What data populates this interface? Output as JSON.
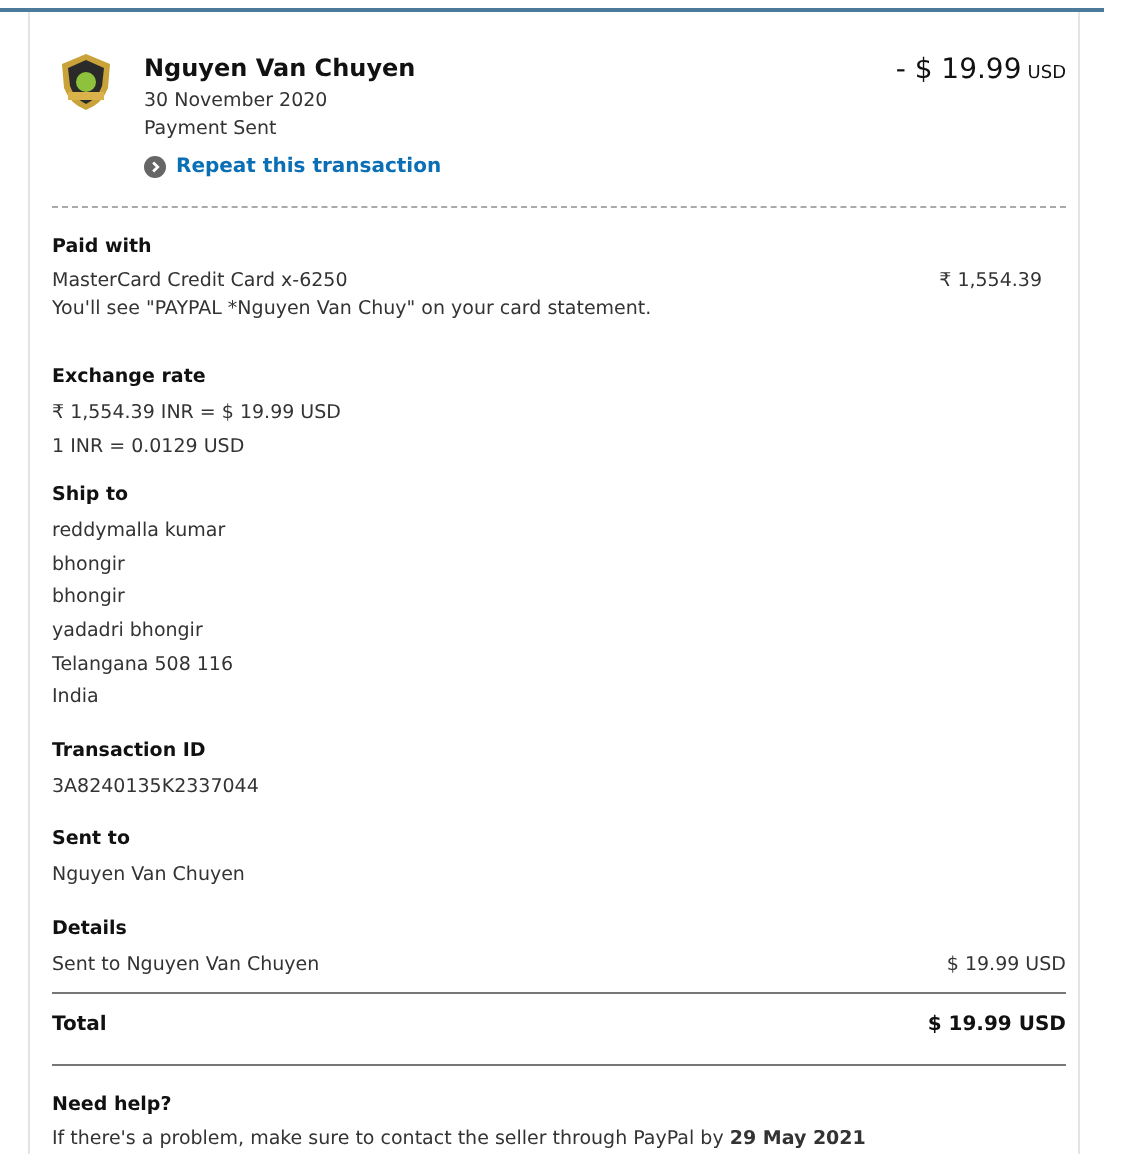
{
  "header": {
    "name": "Nguyen Van Chuyen",
    "date": "30 November 2020",
    "status": "Payment Sent",
    "amount": "- $ 19.99",
    "currency": "USD",
    "repeat_link": "Repeat this transaction"
  },
  "paid_with": {
    "heading": "Paid with",
    "card": "MasterCard Credit Card x-6250",
    "amount": "₹ 1,554.39",
    "note": "You'll see \"PAYPAL *Nguyen Van Chuy\" on your card statement."
  },
  "exchange_rate": {
    "heading": "Exchange rate",
    "lines": [
      "₹ 1,554.39 INR = $ 19.99 USD",
      "1 INR = 0.0129 USD"
    ]
  },
  "ship_to": {
    "heading": "Ship to",
    "lines": [
      "reddymalla kumar",
      "bhongir",
      "bhongir",
      "yadadri bhongir",
      "Telangana 508 116",
      "India"
    ]
  },
  "transaction_id": {
    "heading": "Transaction ID",
    "value": "3A8240135K2337044"
  },
  "sent_to": {
    "heading": "Sent to",
    "value": "Nguyen Van Chuyen"
  },
  "details": {
    "heading": "Details",
    "rows": [
      {
        "label": "Sent to Nguyen Van Chuyen",
        "amount": "$ 19.99 USD"
      }
    ],
    "total_label": "Total",
    "total_amount": "$ 19.99 USD"
  },
  "help": {
    "heading": "Need help?",
    "text": "If there's a problem, make sure to contact the seller through PayPal by **29 May 2021**"
  }
}
